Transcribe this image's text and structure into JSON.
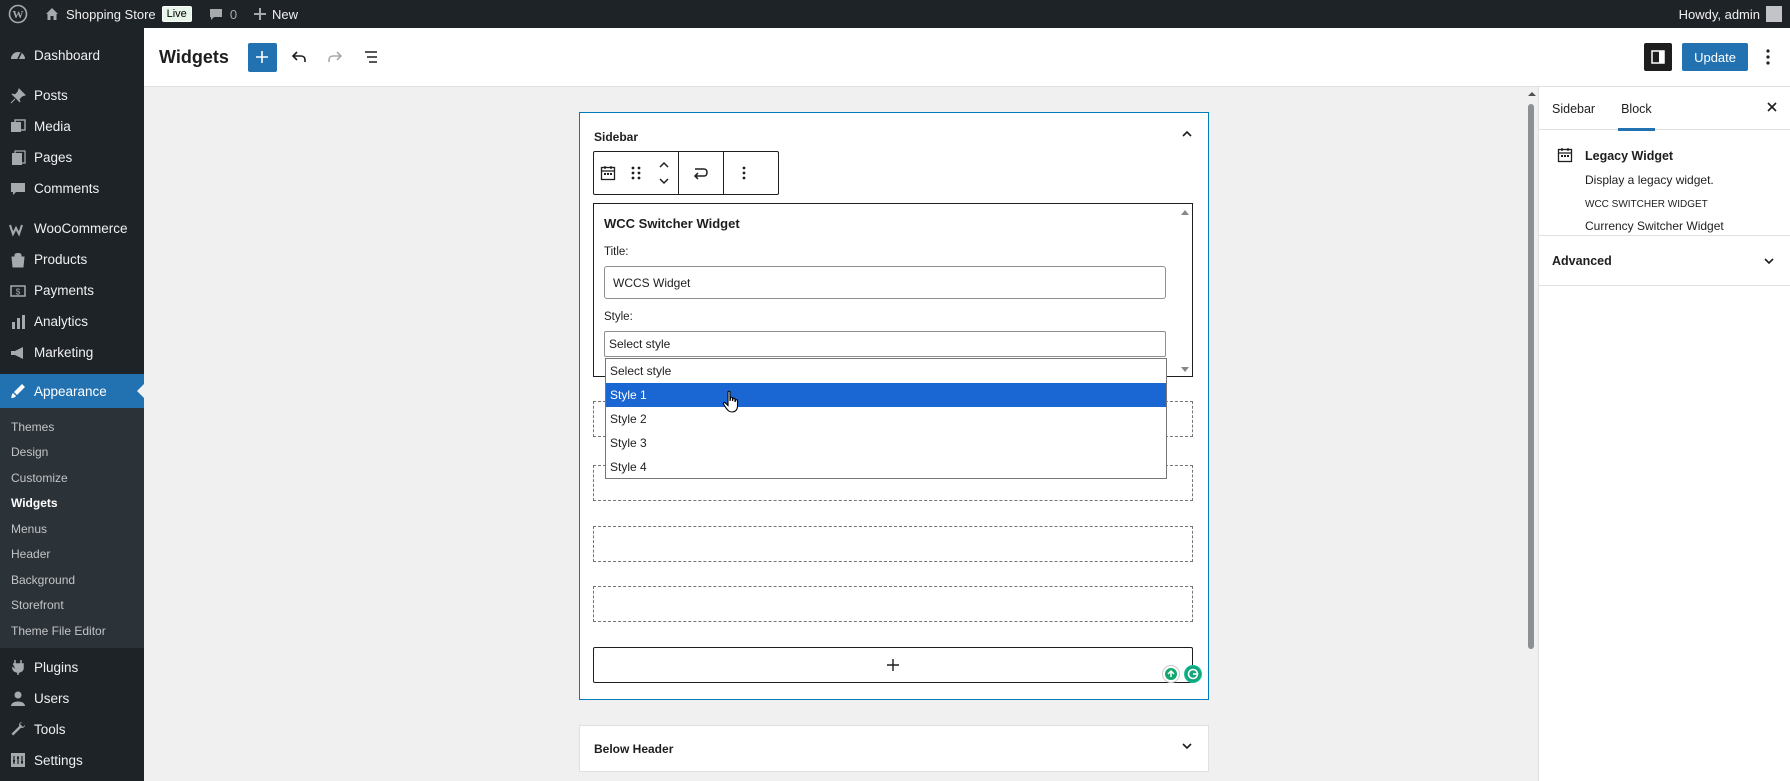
{
  "admin_bar": {
    "site_name": "Shopping Store",
    "live_badge": "Live",
    "comments_count": "0",
    "new_label": "New",
    "greeting": "Howdy, admin"
  },
  "admin_menu": {
    "items_top": [
      {
        "label": "Dashboard",
        "icon": "dashboard-icon"
      },
      {
        "label": "Posts",
        "icon": "pin-icon"
      },
      {
        "label": "Media",
        "icon": "media-icon"
      },
      {
        "label": "Pages",
        "icon": "pages-icon"
      },
      {
        "label": "Comments",
        "icon": "comment-icon"
      },
      {
        "label": "WooCommerce",
        "icon": "woocommerce-icon"
      },
      {
        "label": "Products",
        "icon": "products-icon"
      },
      {
        "label": "Payments",
        "icon": "payments-icon"
      },
      {
        "label": "Analytics",
        "icon": "analytics-icon"
      },
      {
        "label": "Marketing",
        "icon": "marketing-icon"
      }
    ],
    "current": {
      "label": "Appearance",
      "icon": "appearance-icon"
    },
    "submenu": [
      "Themes",
      "Design",
      "Customize",
      "Widgets",
      "Menus",
      "Header",
      "Background",
      "Storefront",
      "Theme File Editor"
    ],
    "submenu_active": "Widgets",
    "items_bottom": [
      {
        "label": "Plugins",
        "icon": "plugins-icon"
      },
      {
        "label": "Users",
        "icon": "users-icon"
      },
      {
        "label": "Tools",
        "icon": "tools-icon"
      },
      {
        "label": "Settings",
        "icon": "settings-icon"
      }
    ]
  },
  "header": {
    "title": "Widgets",
    "update_label": "Update"
  },
  "widget_area": {
    "title": "Sidebar",
    "legacy_widget": {
      "title": "WCC Switcher Widget",
      "title_label": "Title:",
      "title_value": "WCCS Widget",
      "style_label": "Style:",
      "style_selected": "Select style"
    },
    "style_options": [
      "Select style",
      "Style 1",
      "Style 2",
      "Style 3",
      "Style 4"
    ],
    "highlighted_option": "Style 1"
  },
  "below_header": {
    "title": "Below Header"
  },
  "settings_panel": {
    "tabs": [
      "Sidebar",
      "Block"
    ],
    "active_tab": "Block",
    "block_name": "Legacy Widget",
    "block_description": "Display a legacy widget.",
    "widget_type_caps": "WCC SWITCHER WIDGET",
    "widget_type_name": "Currency Switcher Widget",
    "advanced_label": "Advanced"
  },
  "colors": {
    "accent": "#2271b1",
    "admin_dark": "#1d2327",
    "dropdown_highlight": "#1a66d2"
  }
}
